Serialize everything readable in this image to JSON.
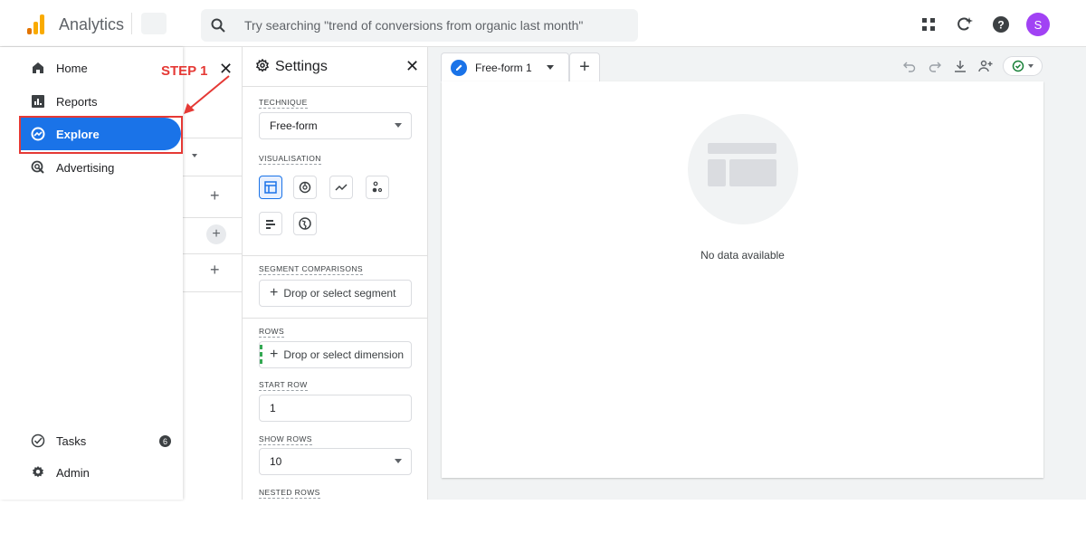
{
  "app": {
    "title": "Analytics"
  },
  "search": {
    "placeholder": "Try searching \"trend of conversions from organic last month\""
  },
  "user": {
    "initial": "S",
    "color": "#a142f4"
  },
  "nav": {
    "items": [
      {
        "label": "Home",
        "icon": "home-icon"
      },
      {
        "label": "Reports",
        "icon": "reports-icon"
      },
      {
        "label": "Explore",
        "icon": "explore-icon",
        "active": true
      },
      {
        "label": "Advertising",
        "icon": "advertising-icon"
      }
    ],
    "bottom": [
      {
        "label": "Tasks",
        "icon": "tasks-icon",
        "badge": "6"
      },
      {
        "label": "Admin",
        "icon": "gear-icon"
      }
    ]
  },
  "annotation": {
    "step_label": "STEP 1",
    "color": "#e53935"
  },
  "settings": {
    "title": "Settings",
    "technique_label": "TECHNIQUE",
    "technique_value": "Free-form",
    "visualisation_label": "VISUALISATION",
    "segment_label": "SEGMENT COMPARISONS",
    "segment_placeholder": "Drop or select segment",
    "rows_label": "ROWS",
    "rows_placeholder": "Drop or select dimension",
    "start_row_label": "START ROW",
    "start_row_value": "1",
    "show_rows_label": "SHOW ROWS",
    "show_rows_value": "10",
    "nested_rows_label": "NESTED ROWS"
  },
  "canvas": {
    "tab_label": "Free-form 1",
    "empty_text": "No data available"
  },
  "colors": {
    "accent": "#1a73e8",
    "highlight": "#e53935"
  }
}
